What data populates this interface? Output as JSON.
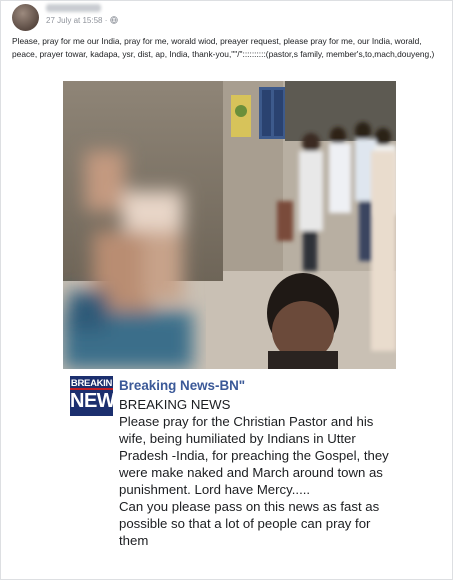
{
  "post": {
    "timestamp": "27 July at 15:58",
    "privacy_icon": "globe-icon",
    "caption": "Please, pray for me our India, pray for me, worald wiod, preayer request, please pray for me, our India, worald, peace, prayer towar, kadapa, ysr, dist, ap, India, thank-you,\"\"/\"::::::::::(pastor,s family, member's,to,mach,douyeng,)"
  },
  "shared": {
    "logo_line1": "BREAKIN",
    "logo_line2": "NEWS",
    "page_name": "Breaking News-BN\"",
    "heading": "BREAKING NEWS",
    "paragraph1": "Please pray for the Christian Pastor and his wife, being humiliated by Indians in Utter Pradesh -India, for preaching the Gospel, they were make naked and March around town as punishment. Lord have Mercy.....",
    "paragraph2": "Can you please pass on this news as fast as possible so that a lot of people can pray for them"
  },
  "colors": {
    "page_link": "#3b5998",
    "logo_bg": "#1b2f6e",
    "logo_accent": "#c21d24",
    "meta_text": "#90949c"
  }
}
